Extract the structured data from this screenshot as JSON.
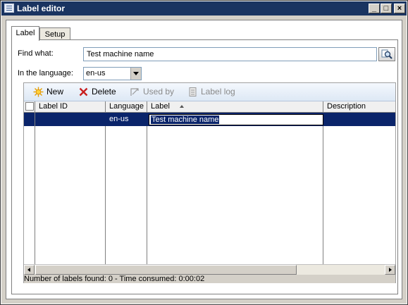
{
  "window": {
    "title": "Label editor"
  },
  "tabs": [
    {
      "label": "Label"
    },
    {
      "label": "Setup"
    }
  ],
  "find": {
    "label": "Find what:",
    "value": "Test machine name"
  },
  "language": {
    "label": "In the language:",
    "selected": "en-us"
  },
  "toolbar": {
    "new_label": "New",
    "delete_label": "Delete",
    "used_by_label": "Used by",
    "label_log_label": "Label log"
  },
  "grid": {
    "columns": [
      "Label ID",
      "Language",
      "Label",
      "Description"
    ],
    "rows": [
      {
        "label_id": "",
        "language": "en-us",
        "label": "Test machine name",
        "description": ""
      }
    ]
  },
  "status": {
    "text": "Number of labels found: 0 - Time consumed:  0:00:02"
  },
  "colors": {
    "titlebar": "#1a3461",
    "selection": "#0a246a",
    "toolbar": "#dde8f5",
    "frame": "#d4d0c8"
  }
}
